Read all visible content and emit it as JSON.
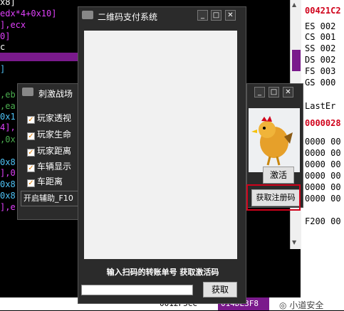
{
  "disassembly": {
    "lines": [
      "x8]",
      "edx*4+0x10]",
      "],ecx",
      "0]",
      "c",
      "]",
      ",eb",
      ",ea",
      "0x1",
      "4],",
      ",0x",
      "0x8",
      "],0",
      "0x8",
      "0x8",
      "],e"
    ]
  },
  "registers": {
    "addr_top": "00421C2",
    "segments": [
      "ES 002",
      "CS 001",
      "SS 002",
      "DS 002",
      "FS 003",
      "GS 000"
    ],
    "last_error": "LastEr",
    "lasterr_val": "0000028",
    "zeros": [
      "0000 00",
      "0000 00",
      "0000 00",
      "0000 00",
      "0000 00",
      "0000 00",
      "F200 00"
    ]
  },
  "bottom_bar": {
    "left_val": "0012F5CC",
    "mid_val": "014DE3F8",
    "watermark": "小道安全"
  },
  "qr_window": {
    "title": "二维码支付系统",
    "hint": "输入扫码的转账单号 获取激活码",
    "order_input_value": "",
    "get_button": "获取"
  },
  "cheat_window": {
    "title": "刺激战场",
    "options": [
      "玩家透视",
      "玩家生命",
      "玩家距离",
      "车辆显示",
      "车距离"
    ],
    "hotkey_label": "开启辅助_F10"
  },
  "activation_window": {
    "activate_button": "激活",
    "register_button": "获取注册码"
  },
  "colors": {
    "window_bg": "#2b2b2b",
    "highlight_red": "#d0021b",
    "asm_purple": "#7a1a8c",
    "checkbox_accent": "#e07b00"
  }
}
